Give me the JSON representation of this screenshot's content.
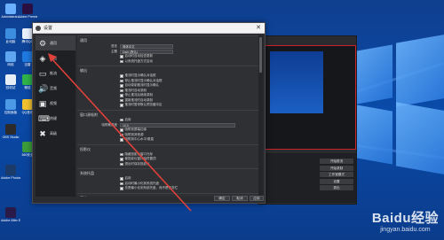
{
  "desktop": {
    "icons": [
      {
        "label": "Administrat...",
        "color": "#6ab0ff"
      },
      {
        "label": "此电脑",
        "color": "#3c8de0"
      },
      {
        "label": "网络",
        "color": "#5fa6f0"
      },
      {
        "label": "回收站",
        "color": "#e8eef5"
      },
      {
        "label": "控制面板",
        "color": "#4c9ae6"
      },
      {
        "label": "OBS Studio",
        "color": "#2b2b2b"
      },
      {
        "label": "Adobe Photosh...",
        "color": "#1b3b6b"
      },
      {
        "label": "Adobe After Effects CC",
        "color": "#2a1a4a"
      }
    ],
    "icons_col2": [
      {
        "label": "Adobe Premiere",
        "color": "#2a1040"
      },
      {
        "label": "腾讯QQ",
        "color": "#e9f1ff"
      },
      {
        "label": "迅雷",
        "color": "#1f7ae0"
      },
      {
        "label": "微信",
        "color": "#2fb24a"
      },
      {
        "label": "QQ音乐",
        "color": "#f2c130"
      },
      {
        "label": "360安全",
        "color": "#3b9b3b"
      }
    ]
  },
  "dialog": {
    "title": "设置",
    "close_glyph": "✕",
    "sidebar": [
      {
        "label": "通用",
        "icon": "gear-icon",
        "glyph": "⚙",
        "active": true
      },
      {
        "label": "输出",
        "icon": "stream-icon",
        "glyph": "◈",
        "active": false
      },
      {
        "label": "推流",
        "icon": "monitor-icon",
        "glyph": "▭",
        "active": false
      },
      {
        "label": "音频",
        "icon": "speaker-icon",
        "glyph": "🔊",
        "active": false
      },
      {
        "label": "视频",
        "icon": "display-icon",
        "glyph": "▣",
        "active": false
      },
      {
        "label": "热键",
        "icon": "keyboard-icon",
        "glyph": "⌨",
        "active": false
      },
      {
        "label": "高级",
        "icon": "wrench-icon",
        "glyph": "✖",
        "active": false
      }
    ],
    "sections": {
      "general": {
        "title": "通用",
        "language_label": "语言",
        "language_value": "简体中文",
        "theme_label": "主题",
        "theme_value": "Dark (默认)",
        "checks": [
          "启动时自动检查更新",
          "以系统托盘方式启动"
        ]
      },
      "output": {
        "title": "输出",
        "checks": [
          "推流时显示确认对话框",
          "停止推流时显示确认对话框",
          "自动录制推流时显示确认",
          "推流时自动录制",
          "停止推流后继续录制",
          "重新推流时自动录制",
          "推流时暂停默认预览缓冲区"
        ]
      },
      "snapping": {
        "title": "窗口源吸附",
        "checks": [
          "启用"
        ],
        "distance_label": "吸附敏感度",
        "distance_value": "10.0",
        "checks2": [
          "吸附到屏幕边缘",
          "吸附到其他源",
          "吸附到中心水平/垂直"
        ]
      },
      "projectors": {
        "title": "投影仪",
        "checks": [
          "隐藏投影仪窗口光标",
          "使投影仪窗口始终置顶",
          "退出时保存投影仪"
        ]
      },
      "tray": {
        "title": "系统托盘",
        "checks": [
          "启用",
          "启动时最小化到系统托盘",
          "总是最小化到系统托盘，而不是任务栏"
        ]
      },
      "preview": {
        "title": "预览",
        "checks": [
          "隐藏溢出",
          "溢出时总是可见",
          "显示源的边框"
        ]
      }
    },
    "footer": {
      "ok": "确定",
      "cancel": "取消",
      "apply": "应用"
    }
  },
  "obs": {
    "controls": [
      "开始推流",
      "开始录制",
      "工作室模式",
      "设置",
      "退出"
    ]
  },
  "watermark": {
    "brand": "Baidu经验",
    "url": "jingyan.baidu.com"
  },
  "colors": {
    "arrow": "#e0403a",
    "dialog_bg": "#2b2c30",
    "accent_red": "#c8232a"
  }
}
